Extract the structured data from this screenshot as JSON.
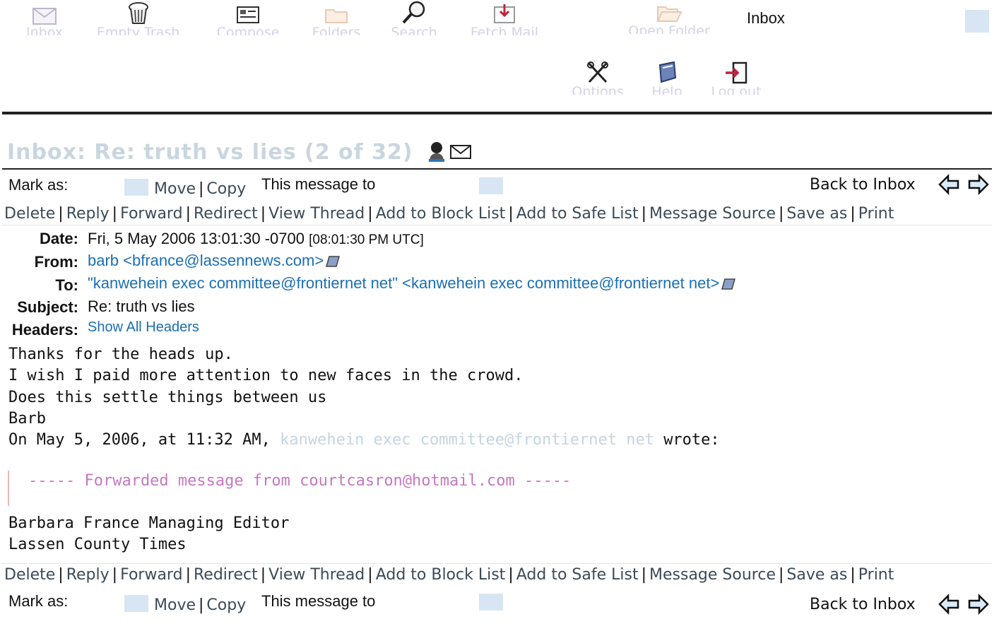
{
  "toolbar": {
    "inbox": "Inbox",
    "empty_trash": "Empty Trash",
    "compose": "Compose",
    "folders": "Folders",
    "search": "Search",
    "fetch_mail": "Fetch Mail",
    "open_folder": "Open Folder",
    "current_folder": "Inbox",
    "options": "Options",
    "help": "Help",
    "log_out": "Log out"
  },
  "page_title": "Inbox: Re: truth vs lies (2 of 32)",
  "actions": {
    "mark_as": "Mark as:",
    "move": "Move",
    "copy": "Copy",
    "this_message_to": "This message to",
    "back_to_inbox": "Back to Inbox",
    "links": [
      "Delete",
      "Reply",
      "Forward",
      "Redirect",
      "View Thread",
      "Add to Block List",
      "Add to Safe List",
      "Message Source",
      "Save as",
      "Print"
    ]
  },
  "headers": {
    "date_label": "Date:",
    "date_value": "Fri, 5 May 2006 13:01:30 -0700",
    "date_utc": "[08:01:30 PM UTC]",
    "from_label": "From:",
    "from_value": "barb <bfrance@lassennews.com>",
    "to_label": "To:",
    "to_value": "\"kanwehein exec committee@frontiernet net\" <kanwehein exec committee@frontiernet net>",
    "subject_label": "Subject:",
    "subject_value": "Re: truth vs lies",
    "headers_label": "Headers:",
    "show_all": "Show All Headers"
  },
  "body": {
    "line1": "Thanks for the heads up.",
    "line2": "I wish I paid more attention to new faces in the crowd.",
    "line3": "Does this settle things between us",
    "line4": "Barb",
    "line5_start": "On May 5, 2006, at 11:32 AM,",
    "line5_link": "kanwehein exec committee@frontiernet net",
    "line5_end": "wrote:",
    "forwarded": "----- Forwarded message from courtcasron@hotmail.com -----",
    "sig1": "Barbara France Managing Editor",
    "sig2": "Lassen County Times"
  },
  "colors": {
    "link": "#1b6fb3",
    "forward_text": "#c678c0",
    "toolbar_label": "#d3d3e6",
    "title": "#c9d6df"
  }
}
